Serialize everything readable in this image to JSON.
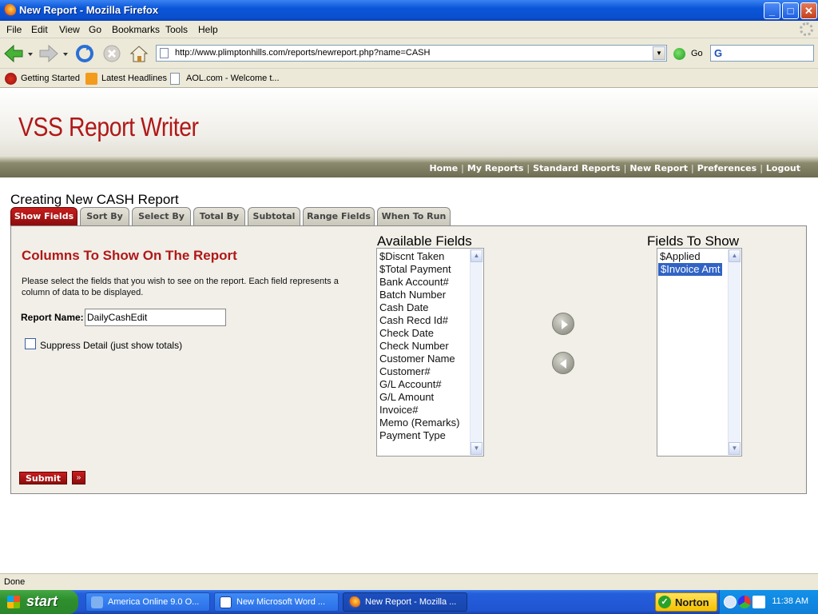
{
  "window": {
    "title": "New Report - Mozilla Firefox",
    "min": "_",
    "max": "□",
    "close": "✕"
  },
  "menu": [
    "File",
    "Edit",
    "View",
    "Go",
    "Bookmarks",
    "Tools",
    "Help"
  ],
  "toolbar": {
    "url": "http://www.plimptonhills.com/reports/newreport.php?name=CASH",
    "go_label": "Go",
    "search_logo": "G"
  },
  "bookmarks": [
    "Getting Started",
    "Latest Headlines",
    "AOL.com - Welcome t..."
  ],
  "app": {
    "title": "VSS Report Writer",
    "nav": [
      "Home",
      "My Reports",
      "Standard Reports",
      "New Report",
      "Preferences",
      "Logout"
    ],
    "nav_sep": "|",
    "page_title": "Creating New CASH Report",
    "tabs": [
      "Show Fields",
      "Sort By",
      "Select By",
      "Total By",
      "Subtotal",
      "Range Fields",
      "When To Run"
    ],
    "section_title": "Columns To Show On The Report",
    "description": "Please select the fields that you wish to see on the report. Each field represents a column of data to be displayed.",
    "report_name_label": "Report Name:",
    "report_name_value": "DailyCashEdit",
    "suppress_label": "Suppress Detail (just show totals)",
    "available_title": "Available Fields",
    "available_fields": [
      "$Discnt Taken",
      "$Total Payment",
      "Bank Account#",
      "Batch Number",
      "Cash Date",
      "Cash Recd Id#",
      "Check Date",
      "Check Number",
      "Customer Name",
      "Customer#",
      "G/L Account#",
      "G/L Amount",
      "Invoice#",
      "Memo (Remarks)",
      "Payment Type"
    ],
    "show_title": "Fields To Show",
    "show_fields": [
      "$Applied",
      "$Invoice Amt"
    ],
    "submit_label": "Submit",
    "ff_glyph": "»"
  },
  "status": "Done",
  "taskbar": {
    "start": "start",
    "tasks": [
      "America Online 9.0 O...",
      "New Microsoft Word ...",
      "New Report - Mozilla ..."
    ],
    "norton": "Norton",
    "clock": "11:38 AM"
  },
  "colors": {
    "brand_red": "#b01818",
    "selection_blue": "#3163c5",
    "nav_olive": "#6e6c52"
  }
}
